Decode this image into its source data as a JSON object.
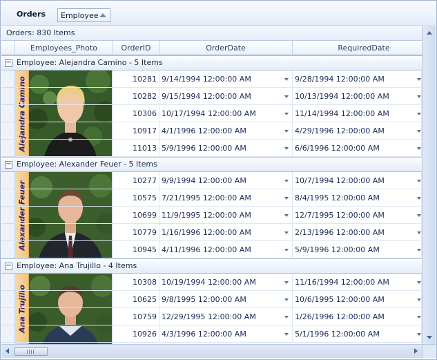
{
  "panel": {
    "title": "Orders",
    "group_by": "Employee"
  },
  "summary": "Orders: 830 Items",
  "columns": {
    "photo": "Employees_Photo",
    "order_id": "OrderID",
    "order_date": "OrderDate",
    "required_date": "RequiredDate"
  },
  "groups": [
    {
      "header": "Employee: Alejandra Camino - 5 Items",
      "name": "Alejandra Camino",
      "rows": [
        {
          "id": "10281",
          "order_date": "9/14/1994 12:00:00 AM",
          "required_date": "9/28/1994 12:00:00 AM"
        },
        {
          "id": "10282",
          "order_date": "9/15/1994 12:00:00 AM",
          "required_date": "10/13/1994 12:00:00 AM"
        },
        {
          "id": "10306",
          "order_date": "10/17/1994 12:00:00 AM",
          "required_date": "11/14/1994 12:00:00 AM"
        },
        {
          "id": "10917",
          "order_date": "4/1/1996 12:00:00 AM",
          "required_date": "4/29/1996 12:00:00 AM"
        },
        {
          "id": "11013",
          "order_date": "5/9/1996 12:00:00 AM",
          "required_date": "6/6/1996 12:00:00 AM"
        }
      ]
    },
    {
      "header": "Employee: Alexander Feuer - 5 Items",
      "name": "Alexander Feuer",
      "rows": [
        {
          "id": "10277",
          "order_date": "9/9/1994 12:00:00 AM",
          "required_date": "10/7/1994 12:00:00 AM"
        },
        {
          "id": "10575",
          "order_date": "7/21/1995 12:00:00 AM",
          "required_date": "8/4/1995 12:00:00 AM"
        },
        {
          "id": "10699",
          "order_date": "11/9/1995 12:00:00 AM",
          "required_date": "12/7/1995 12:00:00 AM"
        },
        {
          "id": "10779",
          "order_date": "1/16/1996 12:00:00 AM",
          "required_date": "2/13/1996 12:00:00 AM"
        },
        {
          "id": "10945",
          "order_date": "4/11/1996 12:00:00 AM",
          "required_date": "5/9/1996 12:00:00 AM"
        }
      ]
    },
    {
      "header": "Employee: Ana Trujillo - 4 Items",
      "name": "Ana Trujillo",
      "rows": [
        {
          "id": "10308",
          "order_date": "10/19/1994 12:00:00 AM",
          "required_date": "11/16/1994 12:00:00 AM"
        },
        {
          "id": "10625",
          "order_date": "9/8/1995 12:00:00 AM",
          "required_date": "10/6/1995 12:00:00 AM"
        },
        {
          "id": "10759",
          "order_date": "12/29/1995 12:00:00 AM",
          "required_date": "1/26/1996 12:00:00 AM"
        },
        {
          "id": "10926",
          "order_date": "4/3/1996 12:00:00 AM",
          "required_date": "5/1/1996 12:00:00 AM"
        }
      ]
    }
  ],
  "colors": {
    "accent": "#f3c47f",
    "border": "#9fb3cf",
    "header": "#e9f0fa"
  }
}
